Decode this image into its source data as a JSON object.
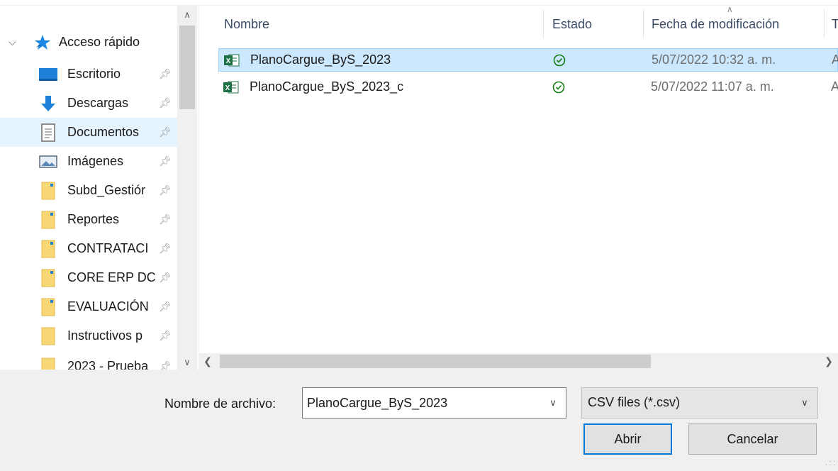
{
  "nav": {
    "items": [
      {
        "label": "Acceso rápido",
        "icon": "star-icon",
        "top": true
      },
      {
        "label": "Escritorio",
        "icon": "desktop-icon",
        "pinned": true
      },
      {
        "label": "Descargas",
        "icon": "download-icon",
        "pinned": true
      },
      {
        "label": "Documentos",
        "icon": "document-icon",
        "pinned": true
      },
      {
        "label": "Imágenes",
        "icon": "pictures-icon",
        "pinned": true
      },
      {
        "label": "Subd_Gestiór",
        "icon": "folder-icon",
        "pinned": true
      },
      {
        "label": "Reportes",
        "icon": "folder-icon",
        "pinned": true
      },
      {
        "label": "CONTRATACI",
        "icon": "folder-icon",
        "pinned": true
      },
      {
        "label": "CORE ERP DC",
        "icon": "folder-icon",
        "pinned": true
      },
      {
        "label": "EVALUACIÓN",
        "icon": "folder-icon",
        "pinned": true
      },
      {
        "label": "Instructivos p",
        "icon": "folder-icon",
        "pinned": true
      },
      {
        "label": "2023 - Prueba",
        "icon": "folder-icon",
        "pinned": true
      }
    ]
  },
  "columns": {
    "name": "Nombre",
    "status": "Estado",
    "modified": "Fecha de modificación",
    "type": "T"
  },
  "files": [
    {
      "name": "PlanoCargue_ByS_2023",
      "date": "5/07/2022 10:32 a. m.",
      "type": "A"
    },
    {
      "name": "PlanoCargue_ByS_2023_c",
      "date": "5/07/2022 11:07 a. m.",
      "type": "A"
    }
  ],
  "footer": {
    "filename_label": "Nombre de archivo:",
    "filename_value": "PlanoCargue_ByS_2023",
    "filetype_value": "CSV files (*.csv)",
    "open_label": "Abrir",
    "cancel_label": "Cancelar"
  },
  "colors": {
    "selected_row": "#cce8ff",
    "nav_selected": "#e5f3ff",
    "accent": "#0078d7",
    "status_green": "#107c10"
  }
}
